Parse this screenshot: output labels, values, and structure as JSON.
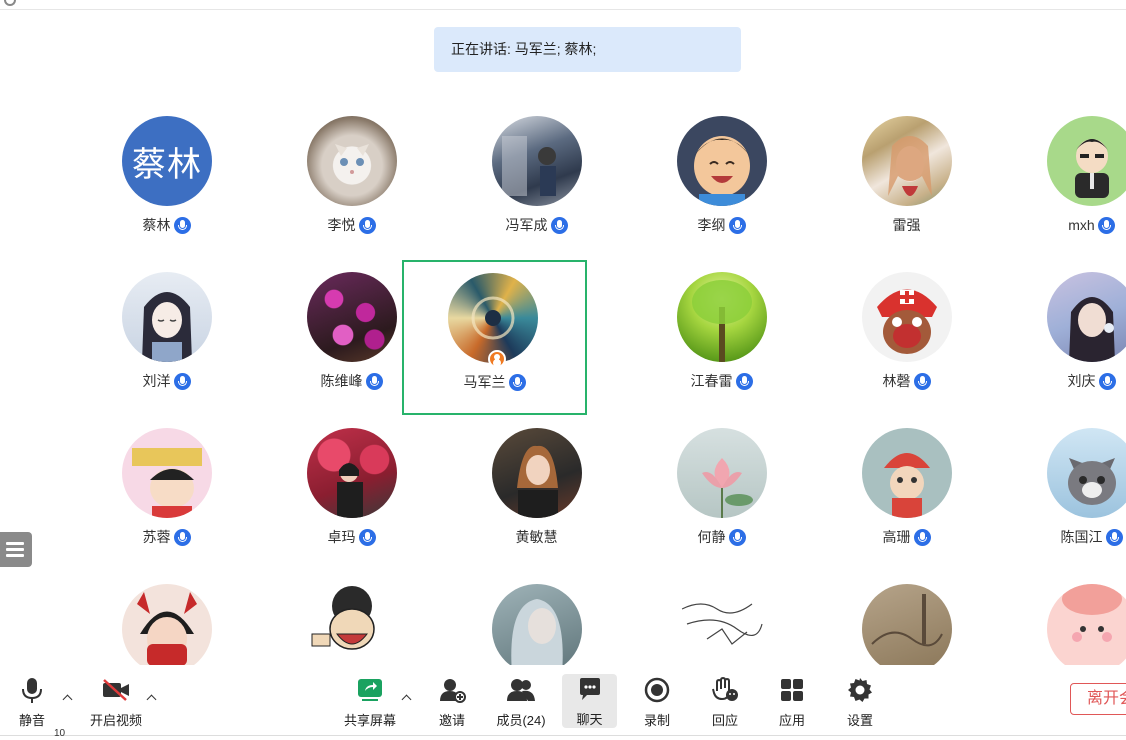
{
  "speaking_banner": "正在讲话: 马军兰; 蔡林;",
  "participants": [
    {
      "name": "蔡林",
      "avatar_text": "蔡林",
      "mic": true
    },
    {
      "name": "李悦",
      "mic": true
    },
    {
      "name": "冯军成",
      "mic": true
    },
    {
      "name": "李纲",
      "mic": true
    },
    {
      "name": "雷强",
      "mic": false
    },
    {
      "name": "mxh",
      "mic": true
    },
    {
      "name": "刘洋",
      "mic": true
    },
    {
      "name": "陈维峰",
      "mic": true
    },
    {
      "name": "马军兰",
      "mic": true,
      "host": true,
      "active_speaker": true
    },
    {
      "name": "江春雷",
      "mic": true
    },
    {
      "name": "林磬",
      "mic": true
    },
    {
      "name": "刘庆",
      "mic": true
    },
    {
      "name": "苏蓉",
      "mic": true
    },
    {
      "name": "卓玛",
      "mic": true
    },
    {
      "name": "黄敏慧",
      "mic": false
    },
    {
      "name": "何静",
      "mic": true
    },
    {
      "name": "高珊",
      "mic": true
    },
    {
      "name": "陈国江",
      "mic": true
    }
  ],
  "toolbar": {
    "mute": "静音",
    "video": "开启视频",
    "share": "共享屏幕",
    "invite": "邀请",
    "members": "成员(24)",
    "chat": "聊天",
    "record": "录制",
    "react": "回应",
    "apps": "应用",
    "settings": "设置",
    "leave": "离开会"
  },
  "bottom_number": "10",
  "colors": {
    "active_border": "#28b36b",
    "mic_blue": "#2c6ee6",
    "leave_red": "#e05757",
    "banner_bg": "#dbe9fb",
    "share_green": "#1aa260"
  }
}
